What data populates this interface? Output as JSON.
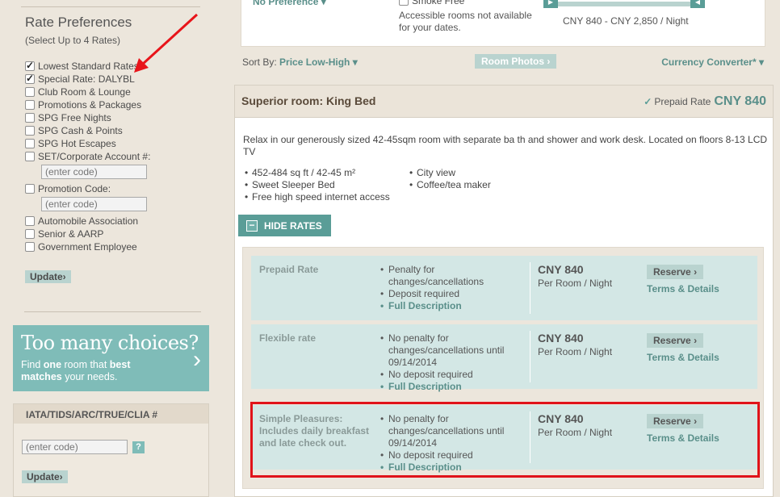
{
  "sidebar": {
    "title": "Rate Preferences",
    "subtitle": "(Select Up to 4 Rates)",
    "rates": [
      {
        "label": "Lowest Standard Rates",
        "checked": true
      },
      {
        "label": "Special Rate: DALYBL",
        "checked": true
      },
      {
        "label": "Club Room & Lounge",
        "checked": false
      },
      {
        "label": "Promotions & Packages",
        "checked": false
      },
      {
        "label": "SPG Free Nights",
        "checked": false
      },
      {
        "label": "SPG Cash & Points",
        "checked": false
      },
      {
        "label": "SPG Hot Escapes",
        "checked": false
      },
      {
        "label": "SET/Corporate Account #:",
        "checked": false
      },
      {
        "label": "Promotion Code:",
        "checked": false
      },
      {
        "label": "Automobile Association",
        "checked": false
      },
      {
        "label": "Senior & AARP",
        "checked": false
      },
      {
        "label": "Government Employee",
        "checked": false
      }
    ],
    "corporate_placeholder": "(enter code)",
    "promo_placeholder": "(enter code)",
    "update_label": "Update",
    "promo_box": {
      "title": "Too many choices?",
      "text_pre": "Find ",
      "text_bold1": "one",
      "text_mid": " room that ",
      "text_bold2": "best matches",
      "text_post": " your needs."
    },
    "iata": {
      "title": "IATA/TIDS/ARC/TRUE/CLIA #",
      "placeholder": "(enter code)",
      "help": "?",
      "update_label": "Update"
    }
  },
  "filters": {
    "bed_pref": "No Preference",
    "smoke_label": "Smoke Free",
    "accessible_note_1": "Accessible rooms not available",
    "accessible_note_2": "for your dates.",
    "price_range": "CNY 840 - CNY 2,850 / Night"
  },
  "sortbar": {
    "sort_label": "Sort By: ",
    "sort_value": "Price Low-High",
    "room_photos": "Room Photos",
    "currency": "Currency Converter*"
  },
  "room": {
    "title": "Superior room: King Bed",
    "prepaid_label": "Prepaid Rate",
    "prepaid_price": "CNY 840",
    "description": "Relax in our generously sized 42-45sqm room with separate ba th and shower and work desk. Located on floors 8-13 LCD TV",
    "amenities_left": [
      "452-484 sq ft / 42-45 m²",
      "Sweet Sleeper Bed",
      "Free high speed internet access"
    ],
    "amenities_right": [
      "City view",
      "Coffee/tea maker"
    ],
    "hide_rates": "HIDE RATES"
  },
  "rates": [
    {
      "name": "Prepaid Rate",
      "bullets": [
        "Penalty for changes/cancellations",
        "Deposit required"
      ],
      "full_desc": "Full Description",
      "price": "CNY 840",
      "unit": "Per Room / Night",
      "reserve": "Reserve",
      "terms": "Terms & Details"
    },
    {
      "name": "Flexible rate",
      "bullets": [
        "No penalty for changes/cancellations until 09/14/2014",
        "No deposit required"
      ],
      "full_desc": "Full Description",
      "price": "CNY 840",
      "unit": "Per Room / Night",
      "reserve": "Reserve",
      "terms": "Terms & Details"
    },
    {
      "name": "Simple Pleasures: Includes daily breakfast and late check out.",
      "bullets": [
        "No penalty for changes/cancellations until 09/14/2014",
        "No deposit required"
      ],
      "full_desc": "Full Description",
      "price": "CNY 840",
      "unit": "Per Room / Night",
      "reserve": "Reserve",
      "terms": "Terms & Details"
    }
  ],
  "colors": {
    "accent": "#5a9d97",
    "rate_bg": "#d3e7e5",
    "highlight": "#e0131a",
    "annotation_arrow": "#e8141a"
  }
}
